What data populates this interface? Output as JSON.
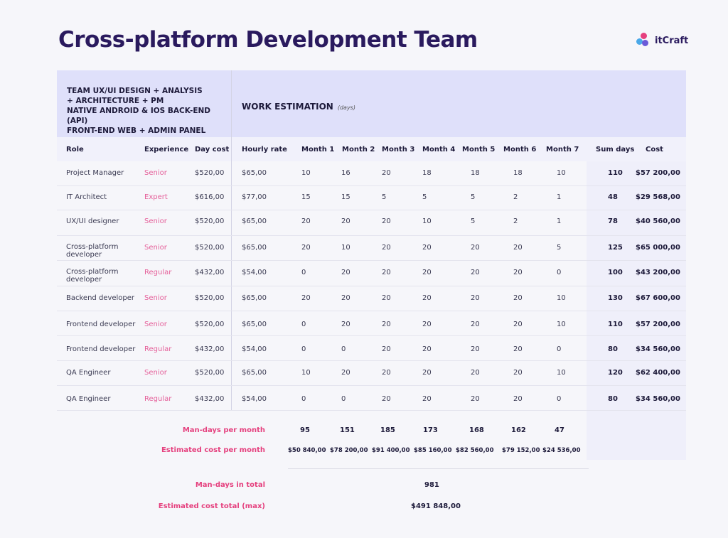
{
  "title": "Cross-platform Development Team",
  "logo": {
    "text": "itCraft",
    "colors": [
      "#e5407e",
      "#4aa8e8",
      "#6a5ad8"
    ]
  },
  "header": {
    "team_lines": [
      "TEAM UX/UI DESIGN + ANALYSIS",
      "+ ARCHITECTURE + PM",
      "NATIVE ANDROID & IOS BACK-END (API)",
      "FRONT-END WEB + ADMIN PANEL"
    ],
    "work_estimation": "WORK ESTIMATION",
    "work_estimation_unit": "(days)"
  },
  "columns": [
    "Role",
    "Experience",
    "Day cost",
    "Hourly rate",
    "Month 1",
    "Month 2",
    "Month 3",
    "Month 4",
    "Month 5",
    "Month 6",
    "Month 7",
    "Sum days",
    "Cost"
  ],
  "rows": [
    {
      "role": "Project Manager",
      "experience": "Senior",
      "day_cost": "$520,00",
      "hourly_rate": "$65,00",
      "months": [
        "10",
        "16",
        "20",
        "18",
        "18",
        "18",
        "10"
      ],
      "sum_days": "110",
      "cost": "$57 200,00"
    },
    {
      "role": "IT Architect",
      "experience": "Expert",
      "day_cost": "$616,00",
      "hourly_rate": "$77,00",
      "months": [
        "15",
        "15",
        "5",
        "5",
        "5",
        "2",
        "1"
      ],
      "sum_days": "48",
      "cost": "$29 568,00"
    },
    {
      "role": "UX/UI designer",
      "experience": "Senior",
      "day_cost": "$520,00",
      "hourly_rate": "$65,00",
      "months": [
        "20",
        "20",
        "20",
        "10",
        "5",
        "2",
        "1"
      ],
      "sum_days": "78",
      "cost": "$40 560,00"
    },
    {
      "role": "Cross-platform developer",
      "experience": "Senior",
      "day_cost": "$520,00",
      "hourly_rate": "$65,00",
      "months": [
        "20",
        "10",
        "20",
        "20",
        "20",
        "20",
        "5"
      ],
      "sum_days": "125",
      "cost": "$65 000,00"
    },
    {
      "role": "Cross-platform developer",
      "experience": "Regular",
      "day_cost": "$432,00",
      "hourly_rate": "$54,00",
      "months": [
        "0",
        "20",
        "20",
        "20",
        "20",
        "20",
        "0"
      ],
      "sum_days": "100",
      "cost": "$43 200,00"
    },
    {
      "role": "Backend developer",
      "experience": "Senior",
      "day_cost": "$520,00",
      "hourly_rate": "$65,00",
      "months": [
        "20",
        "20",
        "20",
        "20",
        "20",
        "20",
        "10"
      ],
      "sum_days": "130",
      "cost": "$67 600,00"
    },
    {
      "role": "Frontend developer",
      "experience": "Senior",
      "day_cost": "$520,00",
      "hourly_rate": "$65,00",
      "months": [
        "0",
        "20",
        "20",
        "20",
        "20",
        "20",
        "10"
      ],
      "sum_days": "110",
      "cost": "$57 200,00"
    },
    {
      "role": "Frontend developer",
      "experience": "Regular",
      "day_cost": "$432,00",
      "hourly_rate": "$54,00",
      "months": [
        "0",
        "0",
        "20",
        "20",
        "20",
        "20",
        "0"
      ],
      "sum_days": "80",
      "cost": "$34 560,00"
    },
    {
      "role": "QA Engineer",
      "experience": "Senior",
      "day_cost": "$520,00",
      "hourly_rate": "$65,00",
      "months": [
        "10",
        "20",
        "20",
        "20",
        "20",
        "20",
        "10"
      ],
      "sum_days": "120",
      "cost": "$62 400,00"
    },
    {
      "role": "QA Engineer",
      "experience": "Regular",
      "day_cost": "$432,00",
      "hourly_rate": "$54,00",
      "months": [
        "0",
        "0",
        "20",
        "20",
        "20",
        "20",
        "0"
      ],
      "sum_days": "80",
      "cost": "$34 560,00"
    }
  ],
  "summary": {
    "man_days_per_month_label": "Man-days per month",
    "man_days_per_month": [
      "95",
      "151",
      "185",
      "173",
      "168",
      "162",
      "47"
    ],
    "cost_per_month_label": "Estimated cost per month",
    "cost_per_month": [
      "$50 840,00",
      "$78 200,00",
      "$91 400,00",
      "$85 160,00",
      "$82 560,00",
      "$79 152,00",
      "$24 536,00"
    ],
    "man_days_total_label": "Man-days in total",
    "man_days_total": "981",
    "cost_total_label": "Estimated cost total (max)",
    "cost_total": "$491 848,00"
  }
}
